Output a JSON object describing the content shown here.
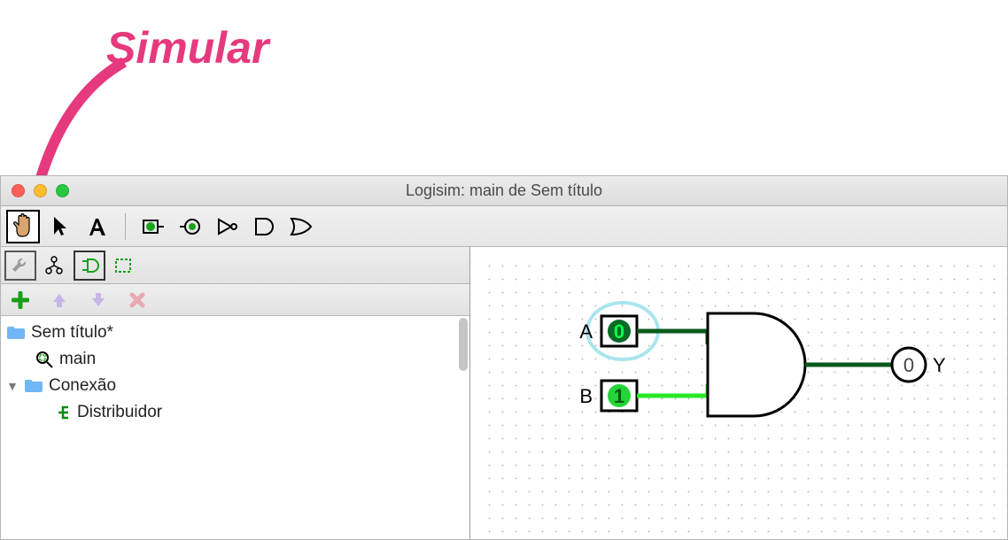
{
  "annotation": {
    "label": "Simular"
  },
  "window": {
    "title": "Logisim: main de Sem título"
  },
  "toolbar": {
    "tools": [
      "poke",
      "select",
      "text",
      "input-pin",
      "output-pin",
      "not-gate",
      "and-gate",
      "or-gate"
    ]
  },
  "tree": {
    "project_name": "Sem título*",
    "circuit_name": "main",
    "library_name": "Conexão",
    "component_name": "Distribuidor"
  },
  "circuit": {
    "inputs": [
      {
        "label": "A",
        "value": "0",
        "state": "low"
      },
      {
        "label": "B",
        "value": "1",
        "state": "high"
      }
    ],
    "output": {
      "label": "Y",
      "value": "0"
    },
    "gate": "AND"
  }
}
